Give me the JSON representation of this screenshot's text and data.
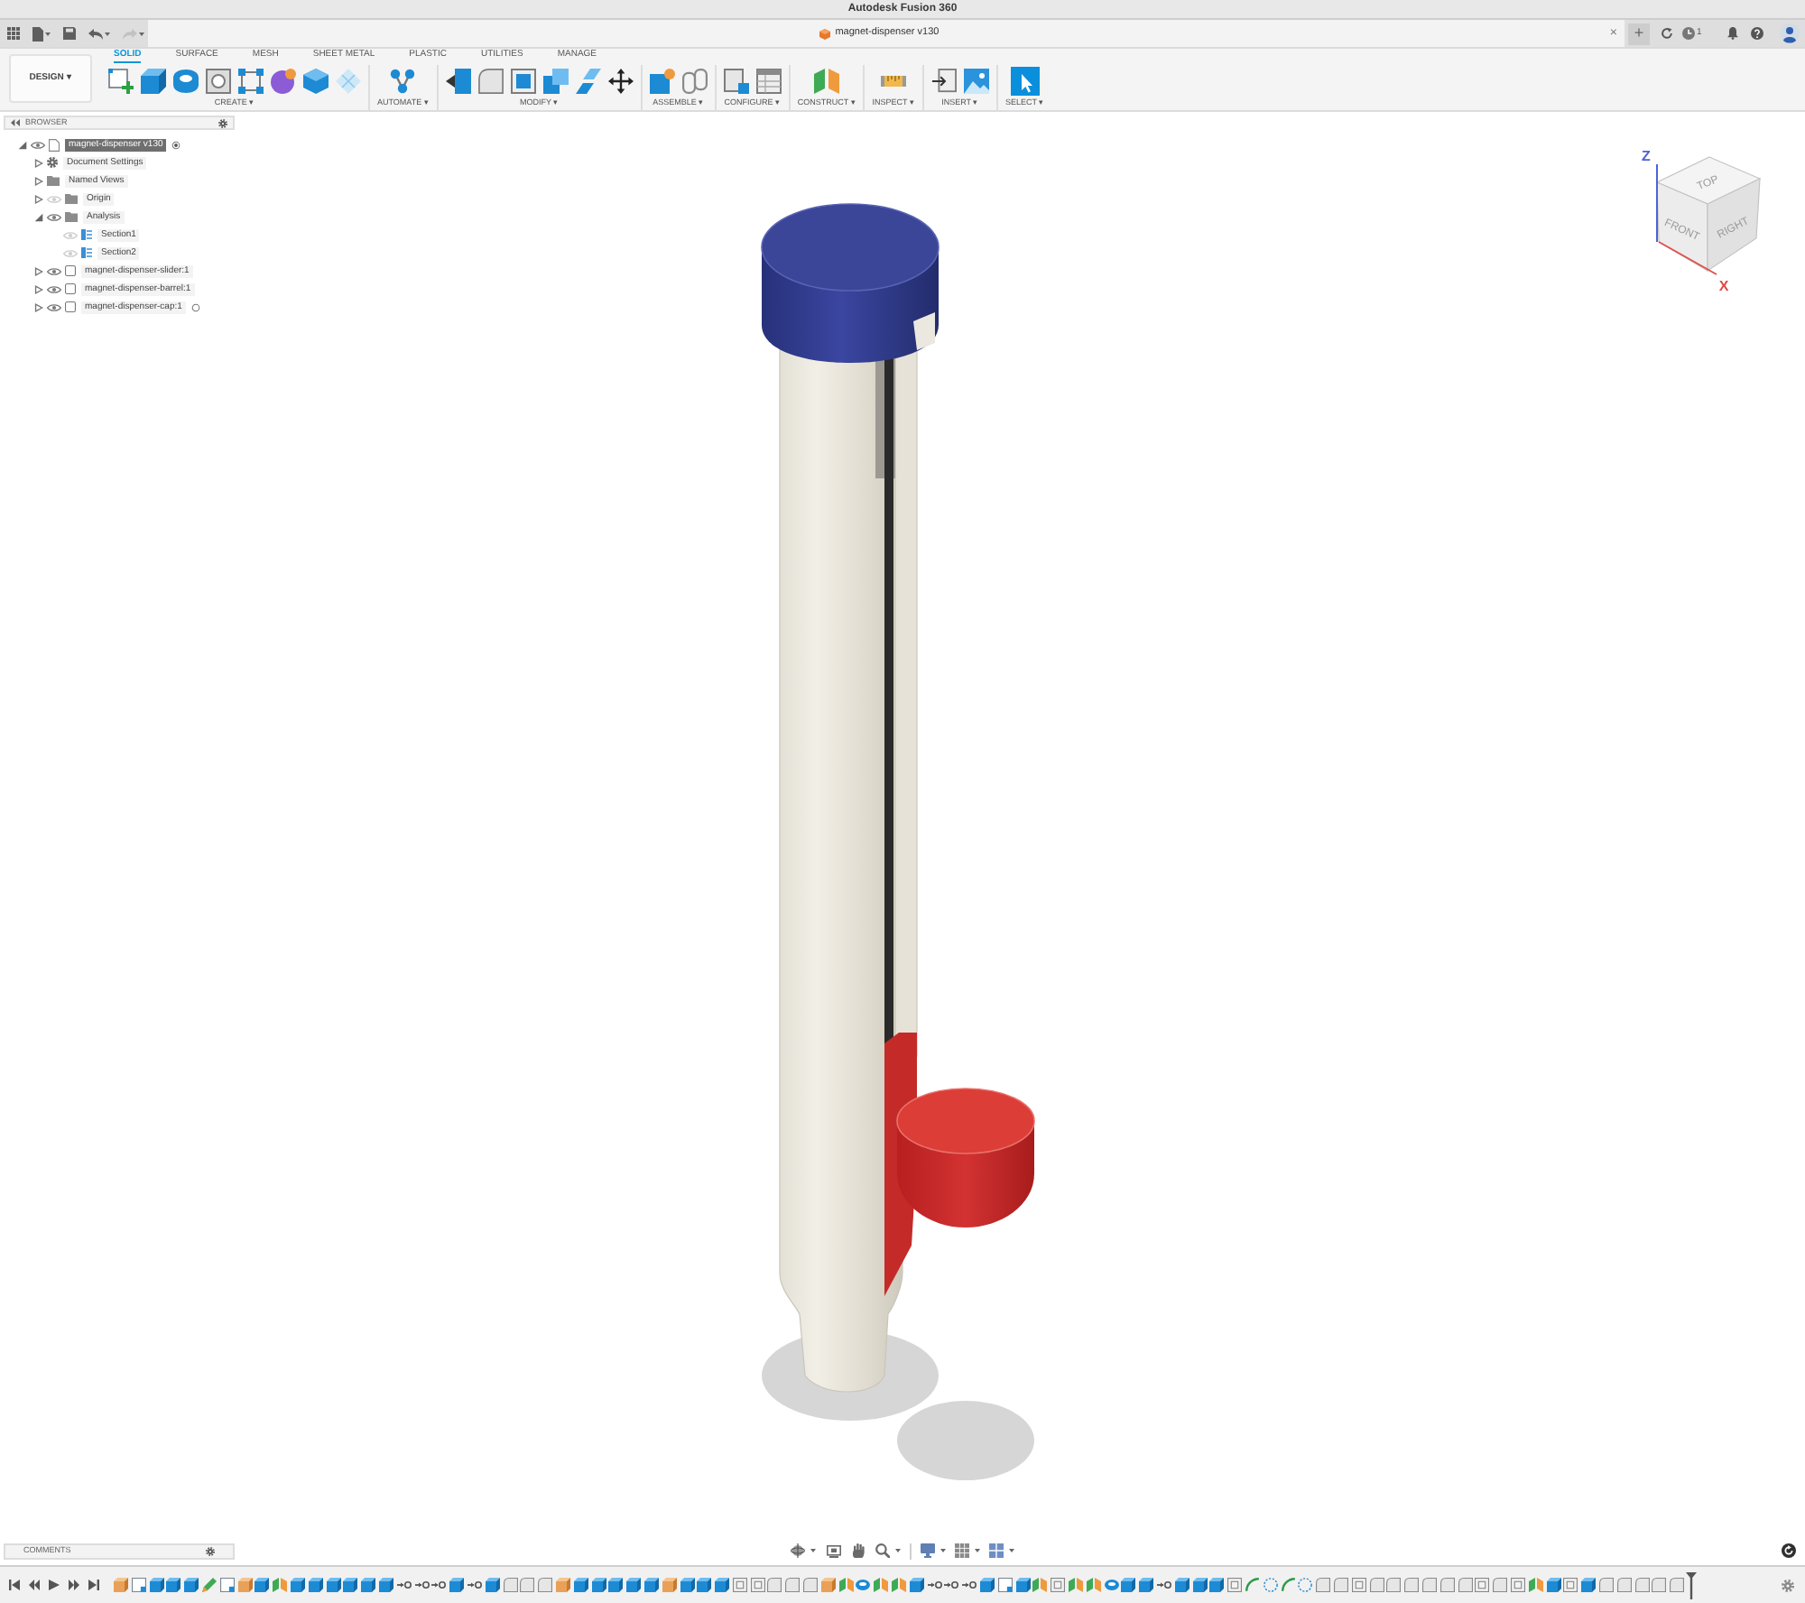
{
  "window": {
    "title": "Autodesk Fusion 360"
  },
  "quick_access": [
    {
      "kind": "grid",
      "disabled": false
    },
    {
      "kind": "file",
      "disabled": false
    },
    {
      "kind": "save",
      "disabled": false
    },
    {
      "kind": "undo",
      "disabled": false
    },
    {
      "kind": "redo",
      "disabled": true
    }
  ],
  "document_tab": {
    "title": "magnet-dispenser v130"
  },
  "header_right": {
    "close_tab": "×",
    "new_tab": "+",
    "job_count": "1"
  },
  "workspace": {
    "label": "DESIGN ▾"
  },
  "tabs": [
    {
      "label": "SOLID",
      "selected": true
    },
    {
      "label": "SURFACE",
      "selected": false
    },
    {
      "label": "MESH",
      "selected": false
    },
    {
      "label": "SHEET METAL",
      "selected": false
    },
    {
      "label": "PLASTIC",
      "selected": false
    },
    {
      "label": "UTILITIES",
      "selected": false
    },
    {
      "label": "MANAGE",
      "selected": false
    }
  ],
  "tool_groups": [
    {
      "label": "CREATE ▾",
      "tools": [
        {
          "kind": "sketch"
        },
        {
          "kind": "extrude"
        },
        {
          "kind": "revolve"
        },
        {
          "kind": "hole"
        },
        {
          "kind": "pattern"
        },
        {
          "kind": "form"
        },
        {
          "kind": "box"
        },
        {
          "kind": "web"
        }
      ]
    },
    {
      "label": "AUTOMATE ▾",
      "tools": [
        {
          "kind": "automate"
        }
      ]
    },
    {
      "label": "MODIFY ▾",
      "tools": [
        {
          "kind": "presspull"
        },
        {
          "kind": "fillet"
        },
        {
          "kind": "shell"
        },
        {
          "kind": "combine"
        },
        {
          "kind": "scale"
        },
        {
          "kind": "move"
        }
      ]
    },
    {
      "label": "ASSEMBLE ▾",
      "tools": [
        {
          "kind": "component"
        },
        {
          "kind": "joint"
        }
      ]
    },
    {
      "label": "CONFIGURE ▾",
      "tools": [
        {
          "kind": "configure"
        },
        {
          "kind": "table"
        }
      ]
    },
    {
      "label": "CONSTRUCT ▾",
      "tools": [
        {
          "kind": "plane"
        }
      ]
    },
    {
      "label": "INSPECT ▾",
      "tools": [
        {
          "kind": "measure"
        }
      ]
    },
    {
      "label": "INSERT ▾",
      "tools": [
        {
          "kind": "insert"
        },
        {
          "kind": "decal"
        }
      ]
    },
    {
      "label": "SELECT ▾",
      "tools": [
        {
          "kind": "select"
        }
      ]
    }
  ],
  "browser": {
    "title": "BROWSER",
    "tree": [
      {
        "label": "magnet-dispenser v130",
        "kind": "document",
        "expanded": true,
        "visible": true,
        "selected": true,
        "active": true,
        "children": [
          {
            "label": "Document Settings",
            "kind": "settings",
            "expanded": false,
            "selected": false
          },
          {
            "label": "Named Views",
            "kind": "folder",
            "expanded": false,
            "selected": false
          },
          {
            "label": "Origin",
            "kind": "folder",
            "expanded": false,
            "visible": false,
            "selected": false
          },
          {
            "label": "Analysis",
            "kind": "folder",
            "expanded": true,
            "visible": true,
            "selected": false,
            "children": [
              {
                "label": "Section1",
                "kind": "section",
                "visible": false,
                "selected": false
              },
              {
                "label": "Section2",
                "kind": "section",
                "visible": false,
                "selected": false
              }
            ]
          },
          {
            "label": "magnet-dispenser-slider:1",
            "kind": "component",
            "expanded": false,
            "visible": true,
            "selected": false
          },
          {
            "label": "magnet-dispenser-barrel:1",
            "kind": "component",
            "expanded": false,
            "visible": true,
            "selected": false
          },
          {
            "label": "magnet-dispenser-cap:1",
            "kind": "component",
            "expanded": false,
            "visible": true,
            "selected": false,
            "active": false
          }
        ]
      }
    ]
  },
  "view_cube": {
    "top": "TOP",
    "front": "FRONT",
    "right": "RIGHT",
    "z_axis": "Z",
    "x_axis": "X"
  },
  "comments": {
    "title": "COMMENTS"
  },
  "timeline": {
    "features": [
      {
        "kind": "component"
      },
      {
        "kind": "sketch"
      },
      {
        "kind": "extrude"
      },
      {
        "kind": "extrude"
      },
      {
        "kind": "extrude"
      },
      {
        "kind": "pencil"
      },
      {
        "kind": "sketch"
      },
      {
        "kind": "component"
      },
      {
        "kind": "extrude"
      },
      {
        "kind": "plane"
      },
      {
        "kind": "extrude"
      },
      {
        "kind": "extrude"
      },
      {
        "kind": "extrude"
      },
      {
        "kind": "extrude"
      },
      {
        "kind": "extrude"
      },
      {
        "kind": "extrude"
      },
      {
        "kind": "joint"
      },
      {
        "kind": "joint"
      },
      {
        "kind": "joint"
      },
      {
        "kind": "extrude"
      },
      {
        "kind": "joint"
      },
      {
        "kind": "extrude"
      },
      {
        "kind": "fillet"
      },
      {
        "kind": "fillet"
      },
      {
        "kind": "fillet"
      },
      {
        "kind": "component"
      },
      {
        "kind": "extrude"
      },
      {
        "kind": "extrude"
      },
      {
        "kind": "extrude"
      },
      {
        "kind": "extrude"
      },
      {
        "kind": "extrude"
      },
      {
        "kind": "component"
      },
      {
        "kind": "extrude"
      },
      {
        "kind": "extrude"
      },
      {
        "kind": "extrude"
      },
      {
        "kind": "shell"
      },
      {
        "kind": "shell"
      },
      {
        "kind": "fillet"
      },
      {
        "kind": "fillet"
      },
      {
        "kind": "fillet"
      },
      {
        "kind": "component"
      },
      {
        "kind": "plane"
      },
      {
        "kind": "revolve"
      },
      {
        "kind": "plane"
      },
      {
        "kind": "plane"
      },
      {
        "kind": "extrude"
      },
      {
        "kind": "joint"
      },
      {
        "kind": "joint"
      },
      {
        "kind": "joint"
      },
      {
        "kind": "extrude"
      },
      {
        "kind": "sketch"
      },
      {
        "kind": "extrude"
      },
      {
        "kind": "plane"
      },
      {
        "kind": "shell"
      },
      {
        "kind": "plane"
      },
      {
        "kind": "plane"
      },
      {
        "kind": "revolve"
      },
      {
        "kind": "extrude"
      },
      {
        "kind": "extrude"
      },
      {
        "kind": "joint"
      },
      {
        "kind": "extrude"
      },
      {
        "kind": "extrude"
      },
      {
        "kind": "extrude"
      },
      {
        "kind": "shell"
      },
      {
        "kind": "arc"
      },
      {
        "kind": "point"
      },
      {
        "kind": "arc"
      },
      {
        "kind": "point"
      },
      {
        "kind": "fillet"
      },
      {
        "kind": "fillet"
      },
      {
        "kind": "shell"
      },
      {
        "kind": "fillet"
      },
      {
        "kind": "fillet"
      },
      {
        "kind": "fillet"
      },
      {
        "kind": "fillet"
      },
      {
        "kind": "fillet"
      },
      {
        "kind": "fillet"
      },
      {
        "kind": "shell"
      },
      {
        "kind": "fillet"
      },
      {
        "kind": "shell"
      },
      {
        "kind": "plane"
      },
      {
        "kind": "extrude"
      },
      {
        "kind": "shell"
      },
      {
        "kind": "extrude"
      },
      {
        "kind": "fillet"
      },
      {
        "kind": "fillet"
      },
      {
        "kind": "fillet"
      },
      {
        "kind": "fillet"
      },
      {
        "kind": "fillet"
      }
    ]
  }
}
